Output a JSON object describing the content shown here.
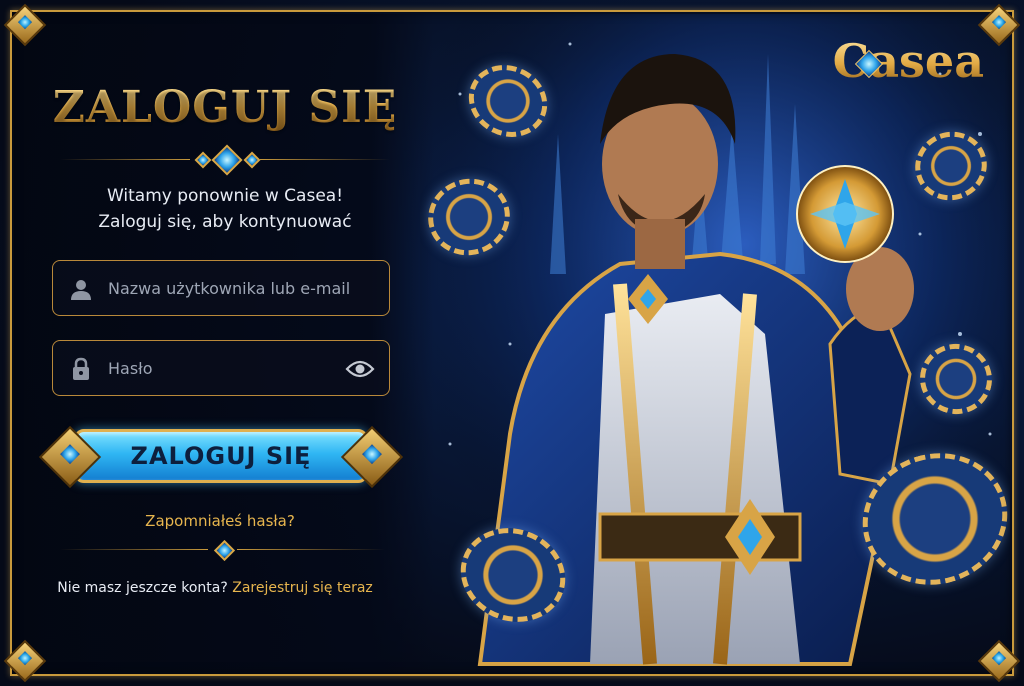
{
  "brand": {
    "logo_text": "asea",
    "logo_initial": "C"
  },
  "login": {
    "title": "ZALOGUJ SIĘ",
    "welcome_line1": "Witamy ponownie w Casea!",
    "welcome_line2": "Zaloguj się, aby kontynuować",
    "username_placeholder": "Nazwa użytkownika lub e-mail",
    "password_placeholder": "Hasło",
    "submit_label": "ZALOGUJ SIĘ",
    "forgot_label": "Zapomniałeś hasła?",
    "no_account_text": "Nie masz jeszcze konta?",
    "register_label": "Zarejestruj się teraz"
  },
  "colors": {
    "gold": "#e7b54e",
    "accent_blue": "#2fb6f3",
    "background": "#050a18"
  },
  "icons": {
    "username": "user-icon",
    "password": "lock-icon",
    "show_password": "eye-icon"
  }
}
